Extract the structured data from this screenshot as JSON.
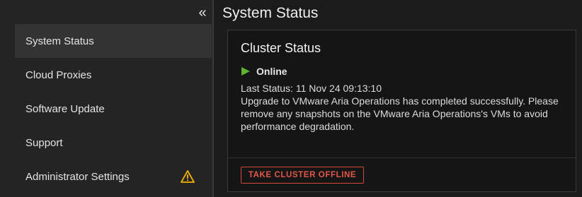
{
  "sidebar": {
    "collapse_icon": "«",
    "items": [
      {
        "label": "System Status",
        "active": true
      },
      {
        "label": "Cloud Proxies"
      },
      {
        "label": "Software Update"
      },
      {
        "label": "Support"
      },
      {
        "label": "Administrator Settings",
        "icon": "warning-icon",
        "icon_color": "#f4b400"
      }
    ]
  },
  "main": {
    "title": "System Status",
    "card": {
      "title": "Cluster Status",
      "status": "Online",
      "status_color": "#5fb52f",
      "last_status": "Last Status: 11 Nov 24 09:13:10",
      "message": "Upgrade to VMware Aria Operations has completed successfully. Please remove any snapshots on the VMware Aria Operations's VMs to avoid performance degradation.",
      "action_label": "TAKE CLUSTER OFFLINE",
      "action_color": "#e2574a"
    }
  }
}
